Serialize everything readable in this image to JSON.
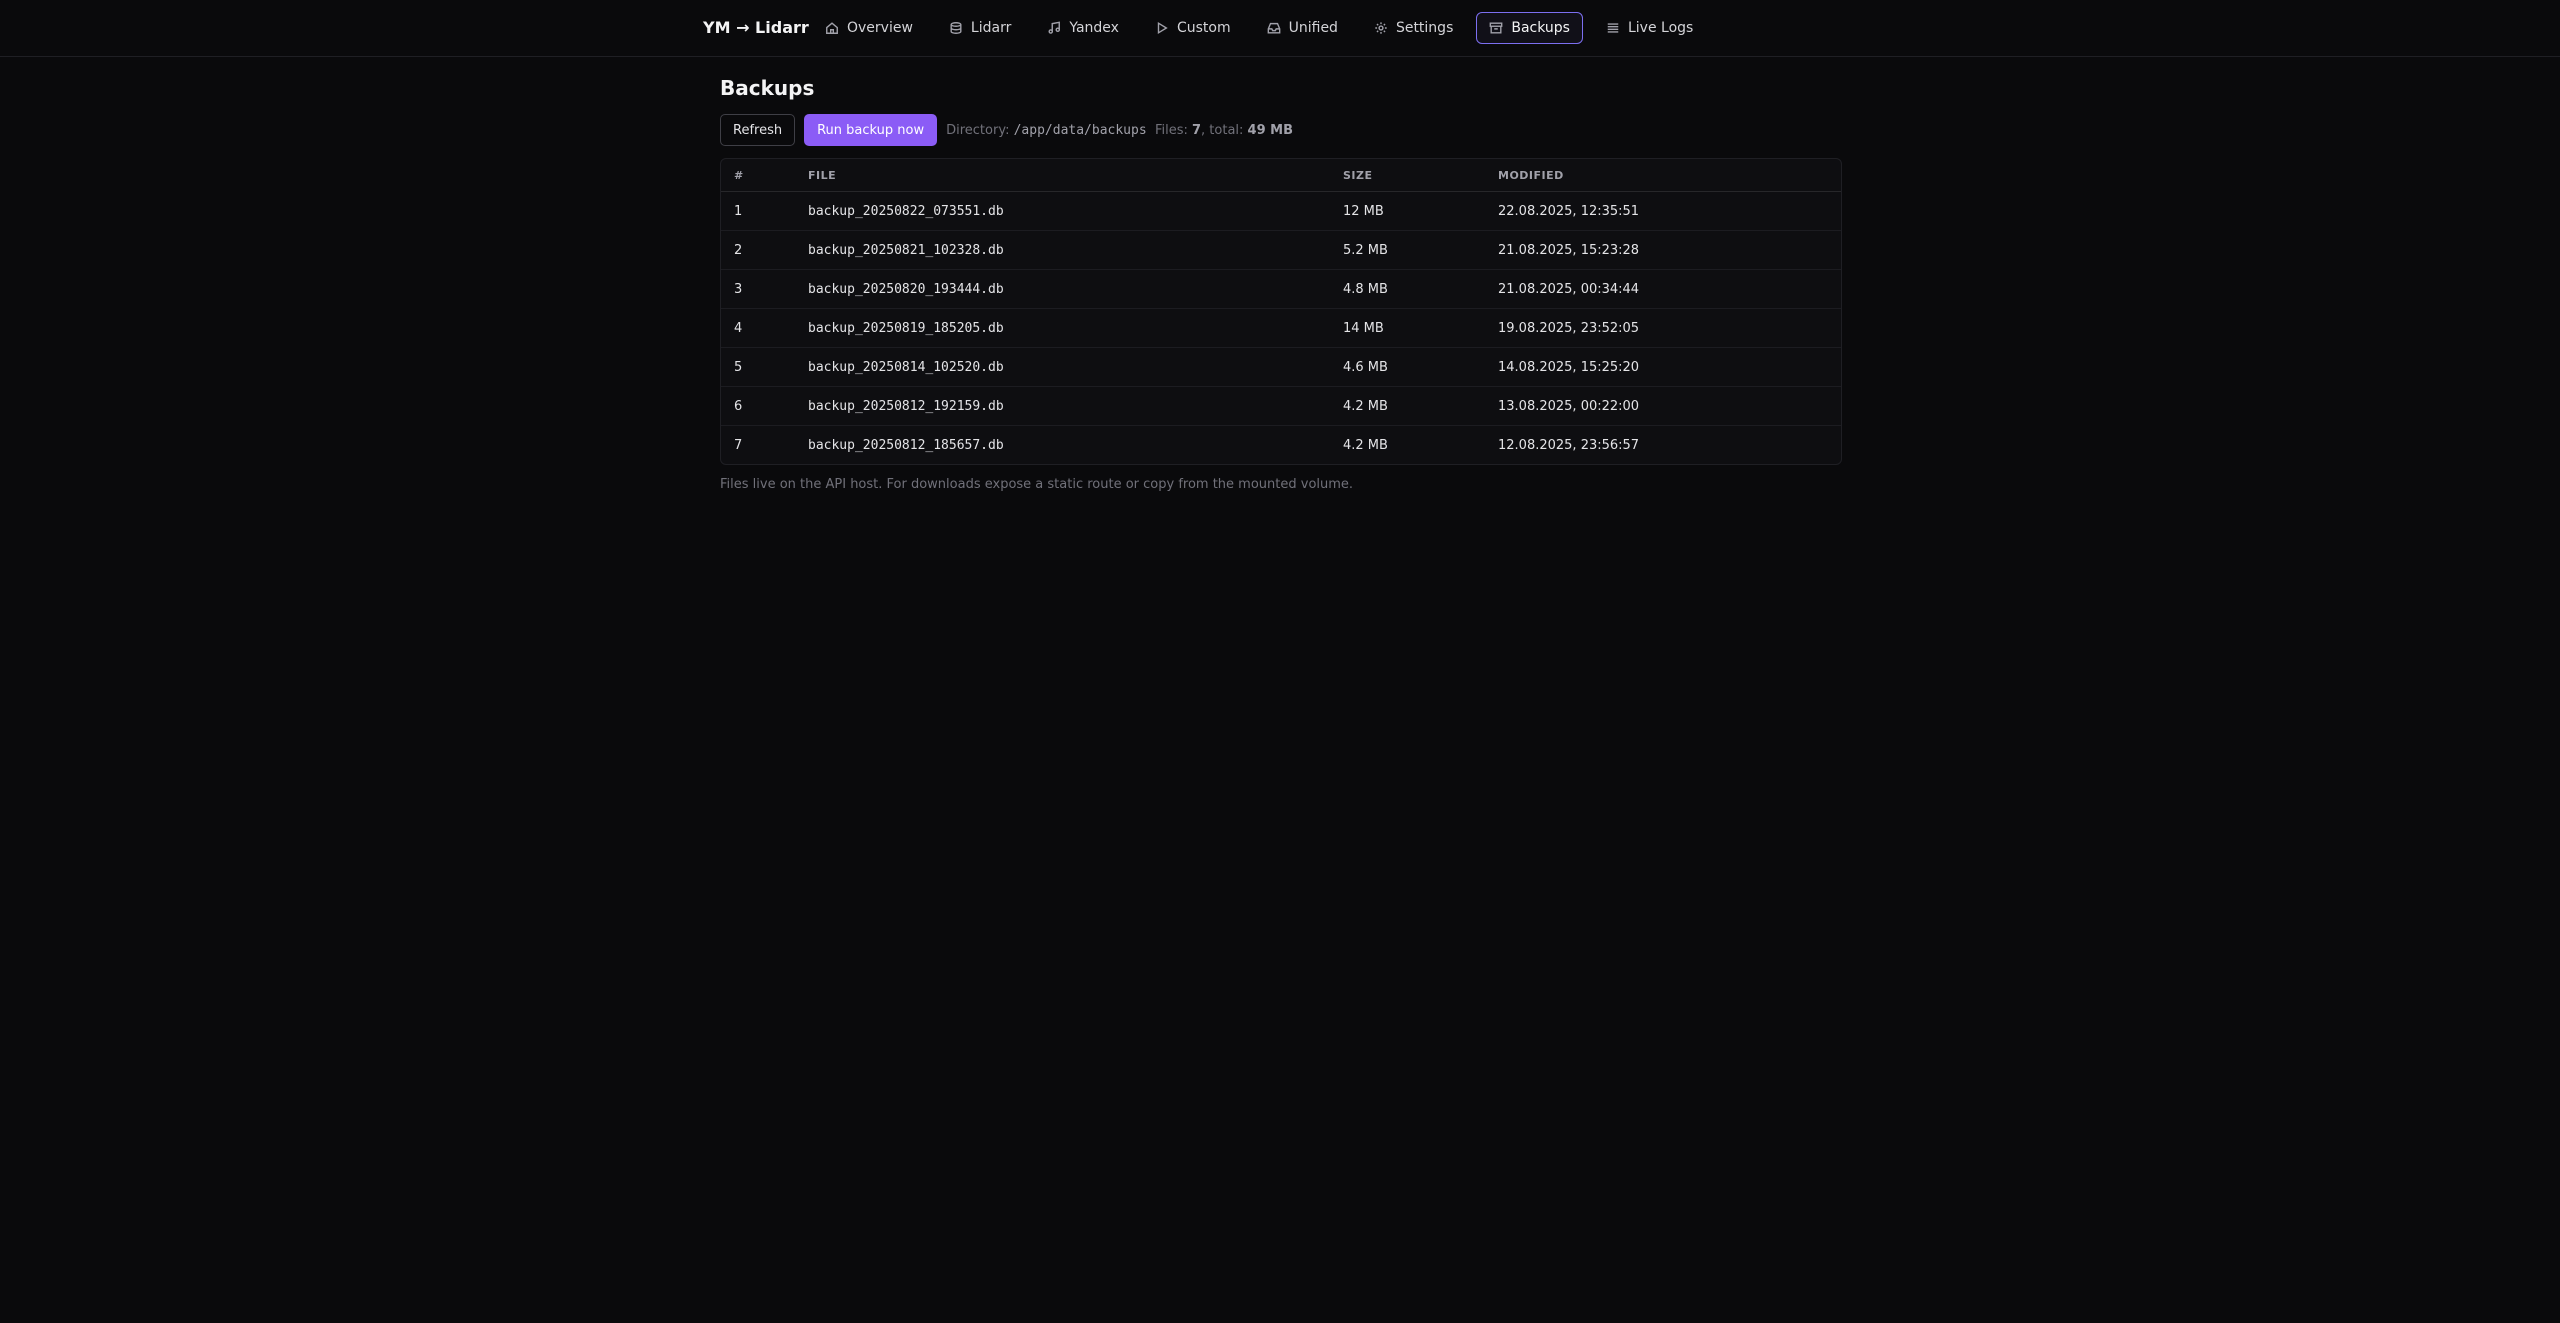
{
  "app": {
    "brand": "YM → Lidarr"
  },
  "nav": [
    {
      "label": "Overview",
      "icon": "home-icon"
    },
    {
      "label": "Lidarr",
      "icon": "database-icon"
    },
    {
      "label": "Yandex",
      "icon": "music-icon"
    },
    {
      "label": "Custom",
      "icon": "play-icon"
    },
    {
      "label": "Unified",
      "icon": "inbox-icon"
    },
    {
      "label": "Settings",
      "icon": "gear-icon"
    },
    {
      "label": "Backups",
      "icon": "archive-icon",
      "active": true
    },
    {
      "label": "Live Logs",
      "icon": "list-icon"
    }
  ],
  "page": {
    "title": "Backups",
    "refresh_label": "Refresh",
    "run_label": "Run backup now",
    "directory_label": "Directory:",
    "directory": "/app/data/backups",
    "files_label": "Files:",
    "files_count": "7",
    "total_label": ", total:",
    "total_size": "49 MB",
    "footnote": "Files live on the API host. For downloads expose a static route or copy from the mounted volume."
  },
  "table": {
    "headers": [
      "#",
      "FILE",
      "SIZE",
      "MODIFIED"
    ],
    "rows": [
      {
        "n": "1",
        "file": "backup_20250822_073551.db",
        "size": "12 MB",
        "modified": "22.08.2025, 12:35:51"
      },
      {
        "n": "2",
        "file": "backup_20250821_102328.db",
        "size": "5.2 MB",
        "modified": "21.08.2025, 15:23:28"
      },
      {
        "n": "3",
        "file": "backup_20250820_193444.db",
        "size": "4.8 MB",
        "modified": "21.08.2025, 00:34:44"
      },
      {
        "n": "4",
        "file": "backup_20250819_185205.db",
        "size": "14 MB",
        "modified": "19.08.2025, 23:52:05"
      },
      {
        "n": "5",
        "file": "backup_20250814_102520.db",
        "size": "4.6 MB",
        "modified": "14.08.2025, 15:25:20"
      },
      {
        "n": "6",
        "file": "backup_20250812_192159.db",
        "size": "4.2 MB",
        "modified": "13.08.2025, 00:22:00"
      },
      {
        "n": "7",
        "file": "backup_20250812_185657.db",
        "size": "4.2 MB",
        "modified": "12.08.2025, 23:56:57"
      }
    ]
  },
  "colors": {
    "background": "#0a0a0c",
    "accent": "#8b5cf6",
    "active_border": "#7c6ff0"
  }
}
